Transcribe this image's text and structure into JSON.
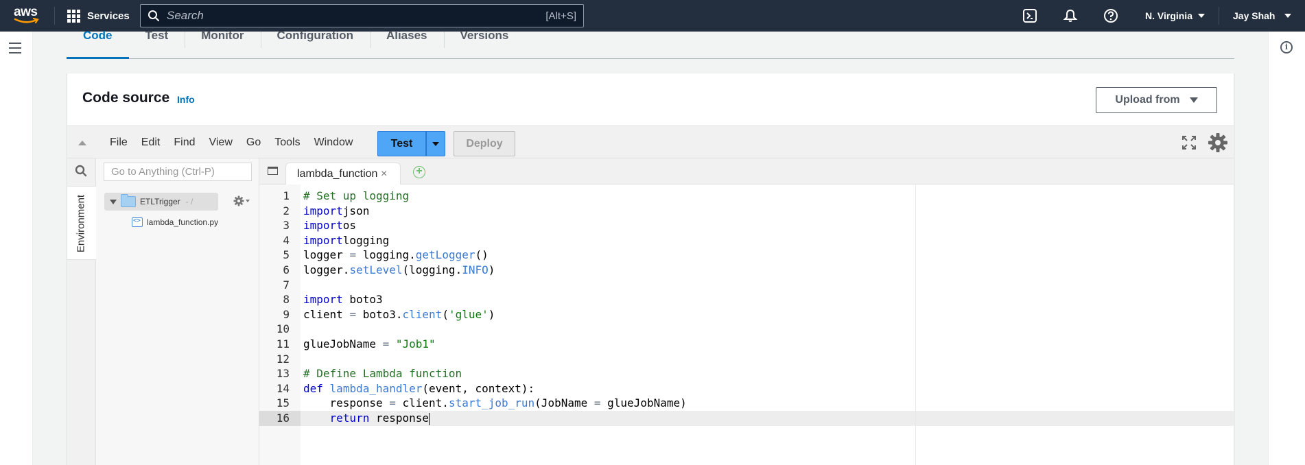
{
  "topnav": {
    "logo": "aws",
    "services_label": "Services",
    "search_placeholder": "Search",
    "search_shortcut": "[Alt+S]",
    "region": "N. Virginia",
    "user": "Jay Shah"
  },
  "tabs": [
    "Code",
    "Test",
    "Monitor",
    "Configuration",
    "Aliases",
    "Versions"
  ],
  "code_source": {
    "title": "Code source",
    "info_label": "Info",
    "upload_label": "Upload from"
  },
  "ide": {
    "menu": [
      "File",
      "Edit",
      "Find",
      "View",
      "Go",
      "Tools",
      "Window"
    ],
    "test_label": "Test",
    "deploy_label": "Deploy",
    "goto_placeholder": "Go to Anything (Ctrl-P)",
    "environment_label": "Environment",
    "tree_root": "ETLTrigger",
    "tree_root_path": "- /",
    "tree_file": "lambda_function.py",
    "active_tab": "lambda_function",
    "tab_close": "×",
    "add_tab": "+"
  },
  "editor": {
    "line_numbers": [
      "1",
      "2",
      "3",
      "4",
      "5",
      "6",
      "7",
      "8",
      "9",
      "10",
      "11",
      "12",
      "13",
      "14",
      "15",
      "16"
    ],
    "active_line": 16,
    "lines": [
      [
        [
          "cm",
          "# Set up logging"
        ]
      ],
      [
        [
          "kw",
          "import"
        ],
        [
          "",
          "json"
        ]
      ],
      [
        [
          "kw",
          "import"
        ],
        [
          "",
          "os"
        ]
      ],
      [
        [
          "kw",
          "import"
        ],
        [
          "",
          "logging"
        ]
      ],
      [
        [
          "",
          "logger "
        ],
        [
          "op",
          "="
        ],
        [
          "",
          " logging."
        ],
        [
          "fn",
          "getLogger"
        ],
        [
          "",
          "()"
        ]
      ],
      [
        [
          "",
          "logger."
        ],
        [
          "fn",
          "setLevel"
        ],
        [
          "",
          "(logging."
        ],
        [
          "fn",
          "INFO"
        ],
        [
          "",
          ")"
        ]
      ],
      [],
      [
        [
          "kw",
          "import"
        ],
        [
          "",
          " boto3"
        ]
      ],
      [
        [
          "",
          "client "
        ],
        [
          "op",
          "="
        ],
        [
          "",
          " boto3."
        ],
        [
          "fn",
          "client"
        ],
        [
          "",
          "("
        ],
        [
          "st",
          "'glue'"
        ],
        [
          "",
          ")"
        ]
      ],
      [],
      [
        [
          "",
          "glueJobName "
        ],
        [
          "op",
          "="
        ],
        [
          "",
          " "
        ],
        [
          "st",
          "\"Job1\""
        ]
      ],
      [],
      [
        [
          "cm",
          "# Define Lambda function"
        ]
      ],
      [
        [
          "kw",
          "def"
        ],
        [
          "",
          " "
        ],
        [
          "fn",
          "lambda_handler"
        ],
        [
          "",
          "(event, context):"
        ]
      ],
      [
        [
          "",
          "    response "
        ],
        [
          "op",
          "="
        ],
        [
          "",
          " client."
        ],
        [
          "fn",
          "start_job_run"
        ],
        [
          "",
          "(JobName "
        ],
        [
          "op",
          "="
        ],
        [
          "",
          " glueJobName)"
        ]
      ],
      [
        [
          "",
          "    "
        ],
        [
          "kw",
          "return"
        ],
        [
          "",
          " response"
        ]
      ]
    ]
  }
}
